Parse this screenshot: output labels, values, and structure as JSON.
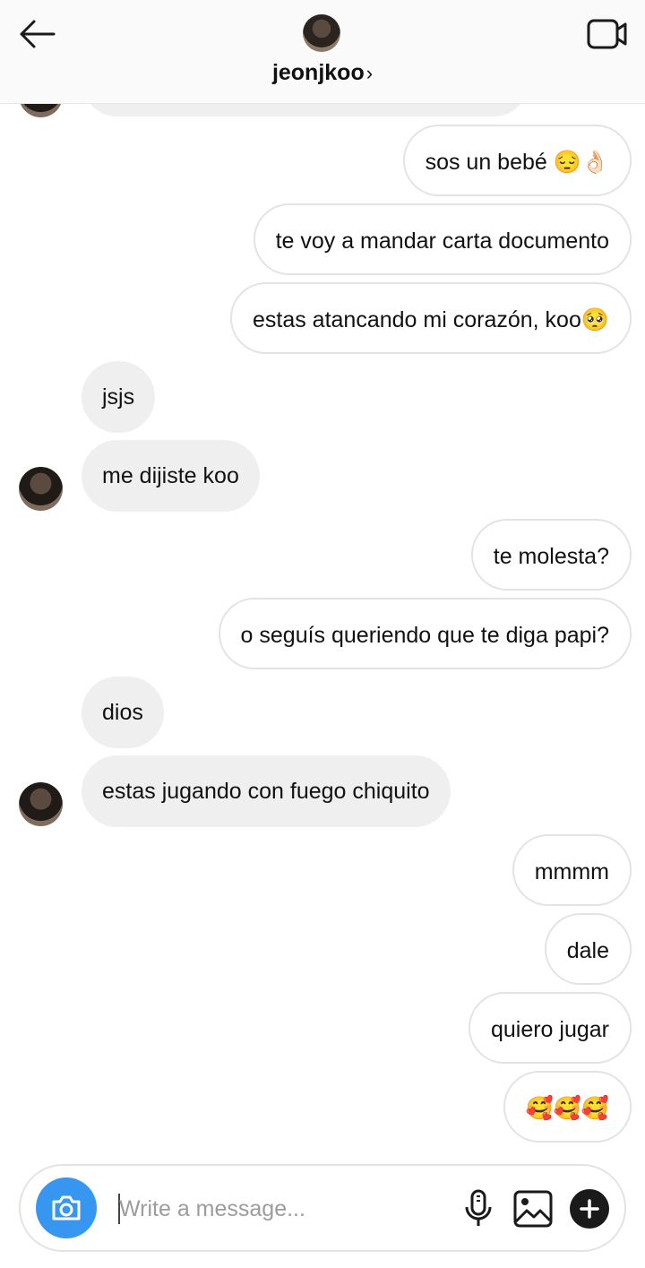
{
  "header": {
    "name": "jeonjkoo",
    "chevron": "›"
  },
  "icons": {
    "back": "back-arrow-icon",
    "video": "video-call-icon",
    "camera": "camera-icon",
    "mic": "microphone-icon",
    "gallery": "gallery-icon",
    "plus": "plus-icon"
  },
  "messages": [
    {
      "from": "me",
      "text": "sos un bebé 😔👌🏻"
    },
    {
      "from": "me",
      "text": "te voy a mandar carta documento"
    },
    {
      "from": "me",
      "text": "estas atancando mi corazón, koo🥺"
    },
    {
      "from": "them",
      "text": "jsjs"
    },
    {
      "from": "them",
      "text": "me dijiste koo"
    },
    {
      "from": "me",
      "text": "te molesta?"
    },
    {
      "from": "me",
      "text": "o seguís queriendo que te diga papi?"
    },
    {
      "from": "them",
      "text": "dios"
    },
    {
      "from": "them",
      "text": "estas jugando con fuego chiquito"
    },
    {
      "from": "me",
      "text": "mmmm"
    },
    {
      "from": "me",
      "text": "dale"
    },
    {
      "from": "me",
      "text": "quiero jugar"
    },
    {
      "from": "me",
      "text": "🥰🥰🥰"
    }
  ],
  "composer": {
    "placeholder": "Write a message...",
    "value": ""
  },
  "colors": {
    "accent": "#3797f0",
    "incoming_bg": "#efefef",
    "outgoing_border": "#e3e3e3"
  }
}
